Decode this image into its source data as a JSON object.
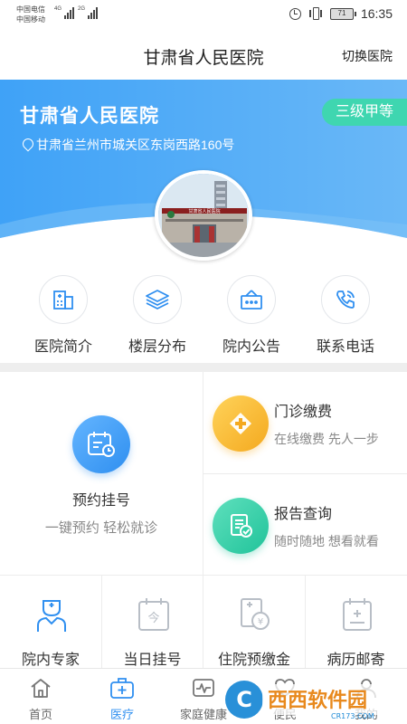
{
  "status_bar": {
    "carrier_1": "中国电信",
    "carrier_2": "中国移动",
    "net_1": "4G",
    "net_2": "2G",
    "battery": "71",
    "time": "16:35"
  },
  "header": {
    "title": "甘肃省人民医院",
    "switch_label": "切换医院"
  },
  "banner": {
    "hospital_name": "甘肃省人民医院",
    "grade": "三级甲等",
    "address": "甘肃省兰州市城关区东岗西路160号",
    "photo_sign": "甘肃省人民医院"
  },
  "quick_nav": [
    {
      "label": "医院简介",
      "icon": "building-icon"
    },
    {
      "label": "楼层分布",
      "icon": "layers-icon"
    },
    {
      "label": "院内公告",
      "icon": "notice-board-icon"
    },
    {
      "label": "联系电话",
      "icon": "phone-icon"
    }
  ],
  "services": {
    "appointment": {
      "title": "预约挂号",
      "subtitle": "一键预约 轻松就诊"
    },
    "payment": {
      "title": "门诊缴费",
      "subtitle": "在线缴费 先人一步"
    },
    "report": {
      "title": "报告查询",
      "subtitle": "随时随地 想看就看"
    },
    "row": [
      {
        "label": "院内专家",
        "icon": "doctor-icon"
      },
      {
        "label": "当日挂号",
        "icon": "calendar-today-icon"
      },
      {
        "label": "住院预缴金",
        "icon": "deposit-icon"
      },
      {
        "label": "病历邮寄",
        "icon": "medical-record-icon"
      }
    ]
  },
  "tabs": [
    {
      "label": "首页",
      "icon": "home-icon"
    },
    {
      "label": "医疗",
      "icon": "medical-kit-icon",
      "active": true
    },
    {
      "label": "家庭健康",
      "icon": "heartbeat-icon"
    },
    {
      "label": "便民",
      "icon": "heart-icon"
    },
    {
      "label": "我的",
      "icon": "user-icon"
    }
  ],
  "watermark": {
    "text": "西西软件园",
    "sub": "CR173.COM"
  },
  "colors": {
    "accent": "#2f8ff0",
    "grade_badge": "#3fd6b0",
    "payment_icon": "#f5b72a",
    "report_icon": "#2fcfa5"
  }
}
